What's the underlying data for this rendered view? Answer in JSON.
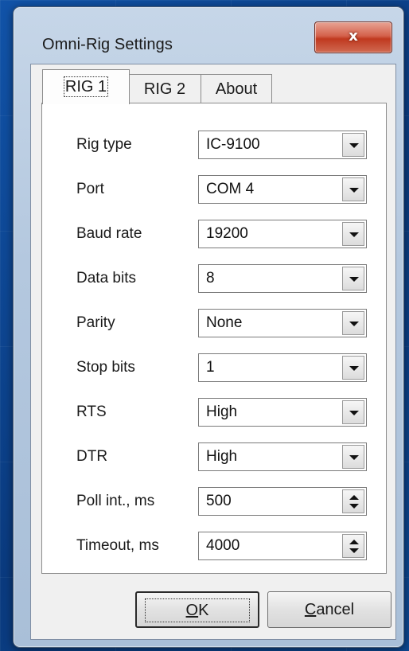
{
  "window": {
    "title": "Omni-Rig Settings",
    "close_glyph": "x"
  },
  "tabs": [
    {
      "label": "RIG 1",
      "active": true
    },
    {
      "label": "RIG 2",
      "active": false
    },
    {
      "label": "About",
      "active": false
    }
  ],
  "fields": [
    {
      "label": "Rig type",
      "value": "IC-9100",
      "control": "dropdown"
    },
    {
      "label": "Port",
      "value": "COM 4",
      "control": "dropdown"
    },
    {
      "label": "Baud rate",
      "value": "19200",
      "control": "dropdown"
    },
    {
      "label": "Data bits",
      "value": "8",
      "control": "dropdown"
    },
    {
      "label": "Parity",
      "value": "None",
      "control": "dropdown"
    },
    {
      "label": "Stop bits",
      "value": "1",
      "control": "dropdown"
    },
    {
      "label": "RTS",
      "value": "High",
      "control": "dropdown"
    },
    {
      "label": "DTR",
      "value": "High",
      "control": "dropdown"
    },
    {
      "label": "Poll int., ms",
      "value": "500",
      "control": "spinner"
    },
    {
      "label": "Timeout, ms",
      "value": "4000",
      "control": "spinner"
    }
  ],
  "buttons": {
    "ok": {
      "first": "O",
      "rest": "K"
    },
    "cancel": {
      "first": "C",
      "rest": "ancel"
    }
  },
  "icons": {
    "close": "close-icon",
    "dropdown": "chevron-down-icon",
    "spinner": "spinner-arrows-icon"
  },
  "colors": {
    "desktop": "#0d3f86",
    "close_button": "#c0391f",
    "client": "#f0f0f0"
  }
}
